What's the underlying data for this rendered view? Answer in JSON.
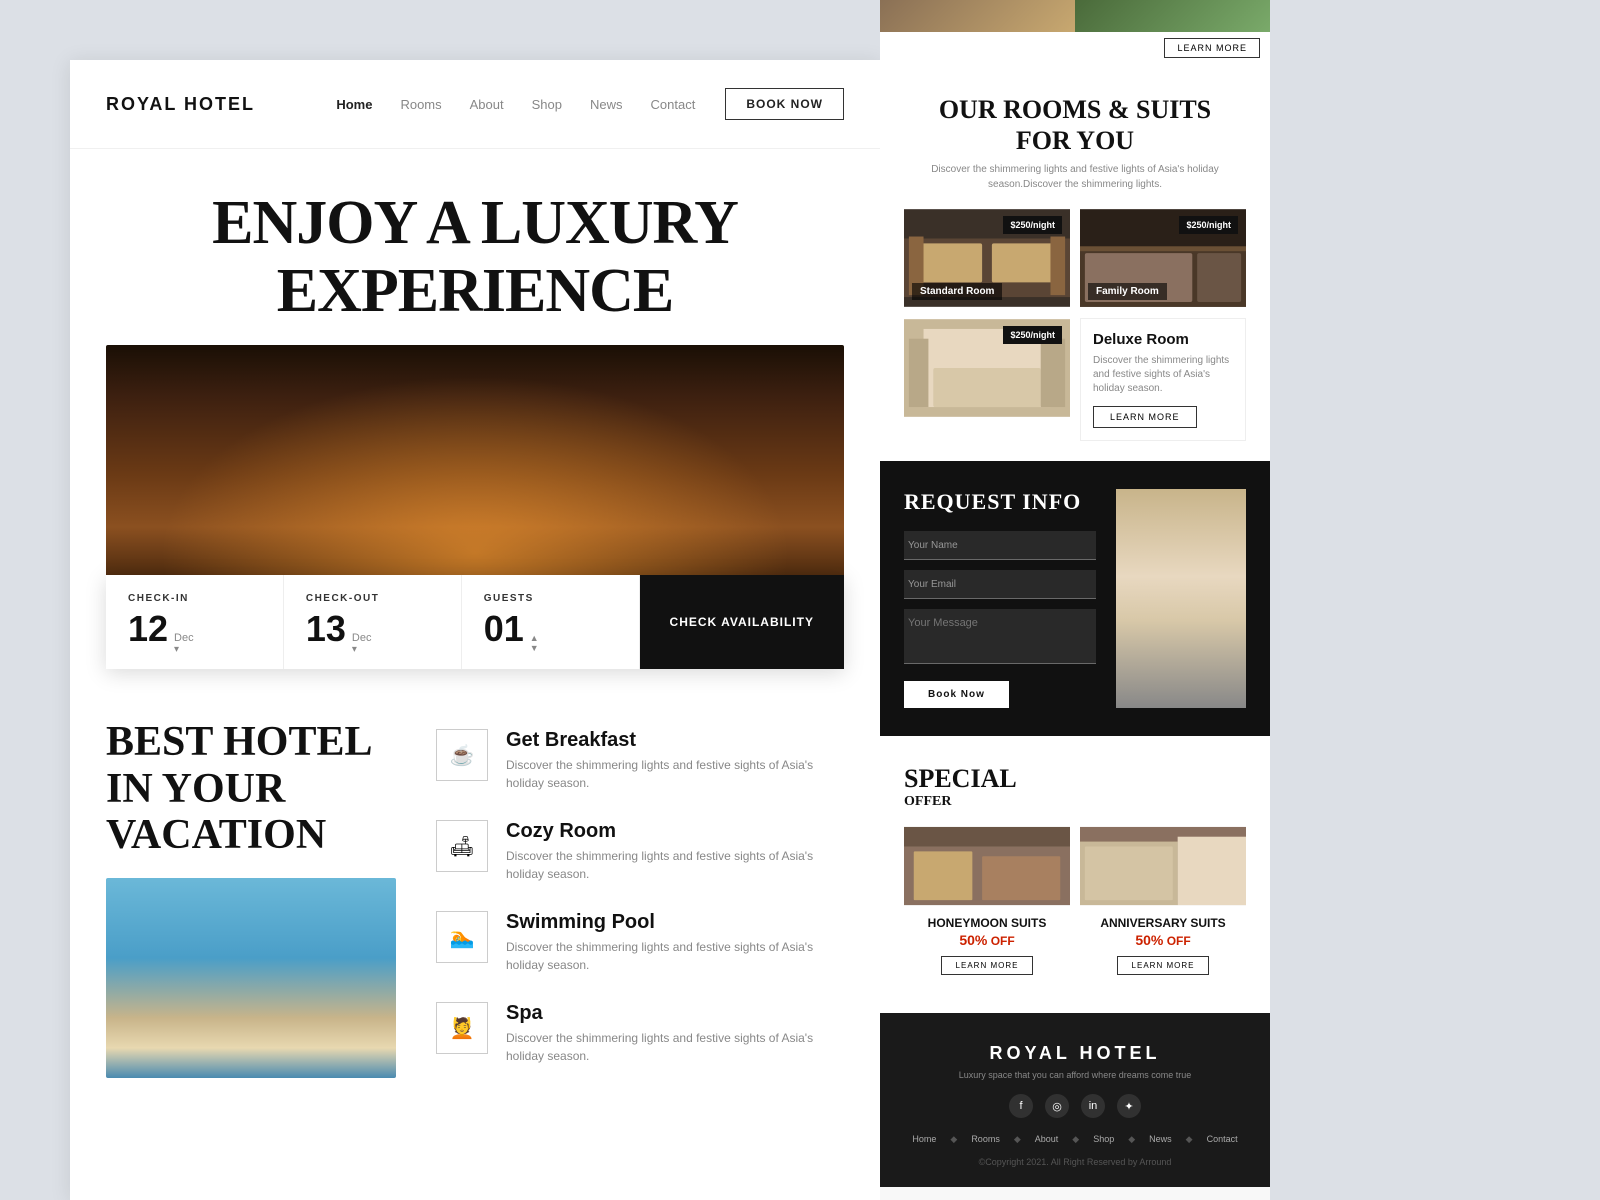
{
  "logo": "ROYAL HOTEL",
  "nav": {
    "items": [
      {
        "label": "Home",
        "active": true
      },
      {
        "label": "Rooms",
        "active": false
      },
      {
        "label": "About",
        "active": false
      },
      {
        "label": "Shop",
        "active": false
      },
      {
        "label": "News",
        "active": false
      },
      {
        "label": "Contact",
        "active": false
      }
    ],
    "book_now": "BOOK NOW"
  },
  "hero": {
    "title_line1": "ENJOY A LUXURY",
    "title_line2": "EXPERIENCE"
  },
  "booking": {
    "checkin_label": "CHECK-IN",
    "checkin_day": "12",
    "checkin_month": "Dec",
    "checkout_label": "CHECK-OUT",
    "checkout_day": "13",
    "checkout_month": "Dec",
    "guests_label": "GUESTS",
    "guests_count": "01",
    "button": "CHECK AVAILABILITY"
  },
  "best_section": {
    "title_line1": "BEST HOTEL",
    "title_line2": "IN YOUR",
    "title_line3": "VACATION"
  },
  "features": [
    {
      "icon": "☕",
      "title": "Get Breakfast",
      "desc": "Discover the shimmering lights and festive sights of Asia's holiday season."
    },
    {
      "icon": "🛋",
      "title": "Cozy Room",
      "desc": "Discover the shimmering lights and festive sights of Asia's holiday season."
    },
    {
      "icon": "🏊",
      "title": "Swimming Pool",
      "desc": "Discover the shimmering lights and festive sights of Asia's holiday season."
    },
    {
      "icon": "💆",
      "title": "Spa",
      "desc": "Discover the shimmering lights and festive sights of Asia's holiday season."
    }
  ],
  "rooms_section": {
    "title": "OUR ROOMS & SUITS",
    "title2": "FOR YOU",
    "subtitle": "Discover the shimmering lights and festive lights of Asia's holiday season.Discover the shimmering lights.",
    "rooms": [
      {
        "name": "Standard Room",
        "price": "$250/night"
      },
      {
        "name": "Family Room",
        "price": "$250/night"
      },
      {
        "name": "Deluxe Room",
        "price": "$250/night",
        "is_info": true,
        "desc": "Discover the shimmering lights and festive sights of Asia's holiday season.",
        "learn_more": "LEARN MORE"
      }
    ]
  },
  "request_info": {
    "title": "REQUEST INFO",
    "name_placeholder": "Your Name",
    "email_placeholder": "Your Email",
    "message_placeholder": "Your Message",
    "submit_label": "Book Now"
  },
  "special_offer": {
    "title": "SPECIAL",
    "title2": "OFFER",
    "offers": [
      {
        "name": "HONEYMOON SUITS",
        "discount": "50%",
        "off": "OFF",
        "learn_more": "LEARN MORE"
      },
      {
        "name": "ANNIVERSARY SUITS",
        "discount": "50%",
        "off": "OFF",
        "learn_more": "LEARN MORE"
      }
    ]
  },
  "footer": {
    "logo": "ROYAL HOTEL",
    "tagline": "Luxury space that you can afford where dreams come true",
    "social": [
      "f",
      "◎",
      "in",
      "✦"
    ],
    "nav_items": [
      "Home",
      "Rooms",
      "About",
      "Shop",
      "News",
      "Contact"
    ],
    "copyright": "©Copyright 2021. All Right Reserved by Arround"
  }
}
